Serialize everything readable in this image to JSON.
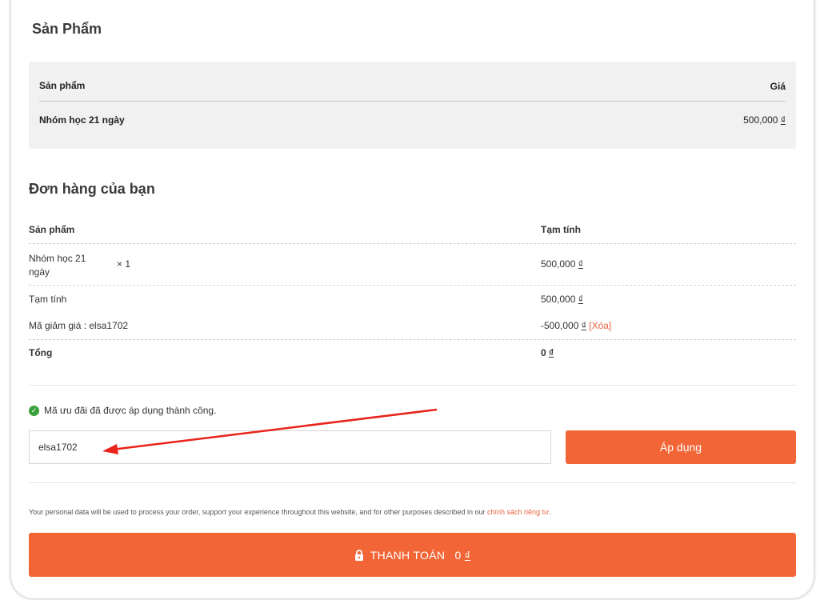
{
  "products_section": {
    "title": "Sản Phẩm",
    "header_product": "Sản phẩm",
    "header_price": "Giá",
    "item_name": "Nhóm học 21 ngày",
    "item_price": "500,000",
    "currency": "₫"
  },
  "order": {
    "title": "Đơn hàng của bạn",
    "col_product": "Sản phẩm",
    "col_subtotal": "Tạm tính",
    "item_name_line1": "Nhóm học 21",
    "item_name_line2": "ngày",
    "item_qty": "× 1",
    "item_total": "500,000",
    "subtotal_label": "Tạm tính",
    "subtotal_value": "500,000",
    "coupon_label": "Mã giảm giá : elsa1702",
    "coupon_value": "-500,000",
    "coupon_remove": "[Xóa]",
    "total_label": "Tổng",
    "total_value": "0",
    "currency": "₫"
  },
  "coupon_notice": "Mã ưu đãi đã được áp dụng thành công.",
  "coupon_input": {
    "value": "elsa1702"
  },
  "apply_button": "Áp dụng",
  "privacy": {
    "text": "Your personal data will be used to process your order, support your experience throughout this website, and for other purposes described in our",
    "link": "chính sách riêng tư",
    "end": "."
  },
  "pay_button": {
    "label": "THANH TOÁN",
    "amount": "0",
    "currency": "₫"
  },
  "colors": {
    "accent": "#f26536",
    "success": "#3aa13a",
    "annotation_arrow": "#e8231b"
  }
}
